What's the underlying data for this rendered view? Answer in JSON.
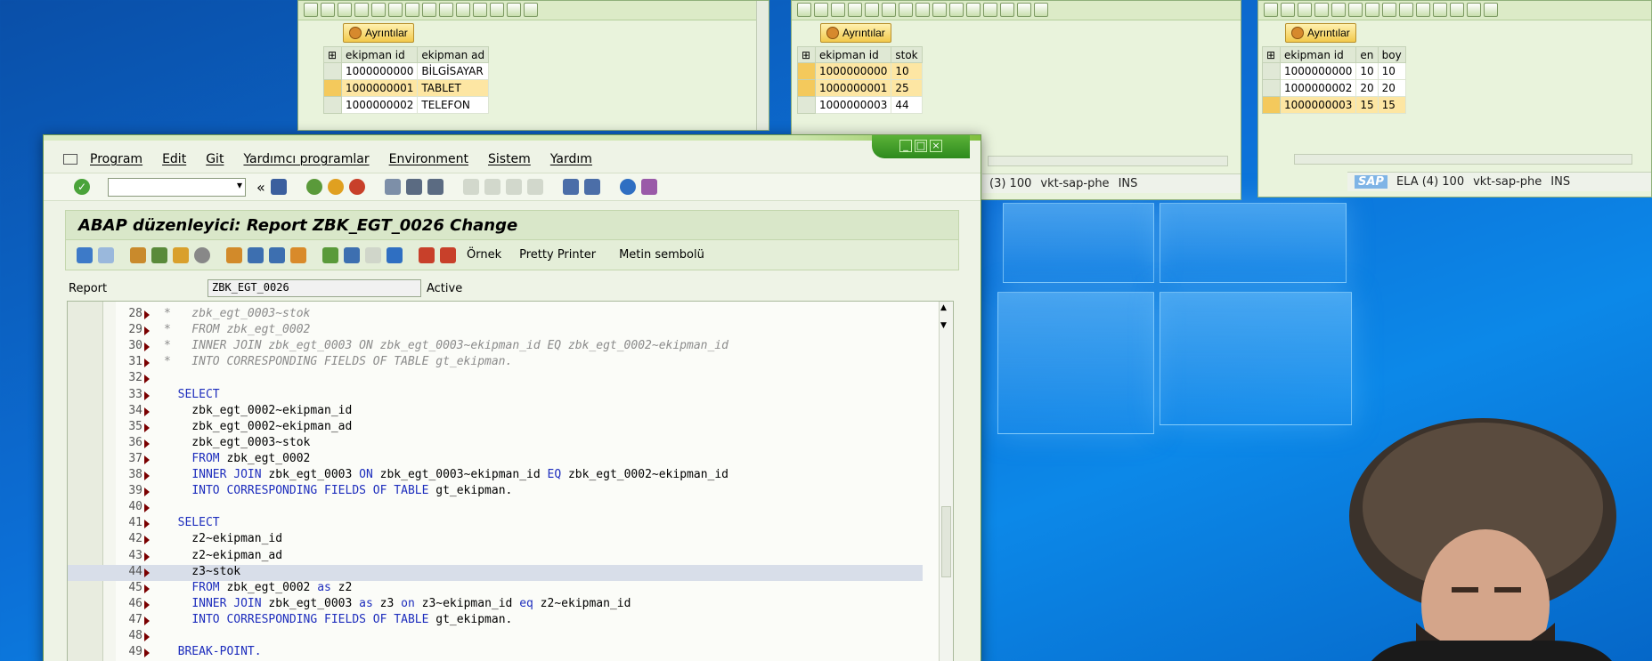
{
  "main_window": {
    "menu": [
      "Program",
      "Edit",
      "Git",
      "Yardımcı programlar",
      "Environment",
      "Sistem",
      "Yardım"
    ],
    "window_controls": [
      "_",
      "□",
      "×"
    ],
    "title": "ABAP düzenleyici: Report ZBK_EGT_0026 Change",
    "toolbar_buttons": [
      "Örnek",
      "Pretty Printer",
      "Metin sembolü"
    ],
    "report_label": "Report",
    "report_name": "ZBK_EGT_0026",
    "report_status": "Active",
    "code_lines": [
      {
        "n": "28",
        "text": "*   zbk_egt_0003~stok",
        "style": "cm"
      },
      {
        "n": "29",
        "text": "*   FROM zbk_egt_0002",
        "style": "cm"
      },
      {
        "n": "30",
        "text": "*   INNER JOIN zbk_egt_0003 ON zbk_egt_0003~ekipman_id EQ zbk_egt_0002~ekipman_id",
        "style": "cm"
      },
      {
        "n": "31",
        "text": "*   INTO CORRESPONDING FIELDS OF TABLE gt_ekipman.",
        "style": "cm"
      },
      {
        "n": "32",
        "text": "",
        "style": ""
      },
      {
        "n": "33",
        "text": "  SELECT",
        "style": "kw"
      },
      {
        "n": "34",
        "text": "    zbk_egt_0002~ekipman_id",
        "style": ""
      },
      {
        "n": "35",
        "text": "    zbk_egt_0002~ekipman_ad",
        "style": ""
      },
      {
        "n": "36",
        "text": "    zbk_egt_0003~stok",
        "style": ""
      },
      {
        "n": "37",
        "text": "    FROM zbk_egt_0002",
        "style": "mix"
      },
      {
        "n": "38",
        "text": "    INNER JOIN zbk_egt_0003 ON zbk_egt_0003~ekipman_id EQ zbk_egt_0002~ekipman_id",
        "style": "mix"
      },
      {
        "n": "39",
        "text": "    INTO CORRESPONDING FIELDS OF TABLE gt_ekipman.",
        "style": "mix"
      },
      {
        "n": "40",
        "text": "",
        "style": ""
      },
      {
        "n": "41",
        "text": "  SELECT",
        "style": "kw"
      },
      {
        "n": "42",
        "text": "    z2~ekipman_id",
        "style": ""
      },
      {
        "n": "43",
        "text": "    z2~ekipman_ad",
        "style": ""
      },
      {
        "n": "44",
        "text": "    z3~stok",
        "style": "cur"
      },
      {
        "n": "45",
        "text": "    FROM zbk_egt_0002 as z2",
        "style": "mix"
      },
      {
        "n": "46",
        "text": "    INNER JOIN zbk_egt_0003 as z3 on z3~ekipman_id eq z2~ekipman_id",
        "style": "mix"
      },
      {
        "n": "47",
        "text": "    INTO CORRESPONDING FIELDS OF TABLE gt_ekipman.",
        "style": "mix"
      },
      {
        "n": "48",
        "text": "",
        "style": ""
      },
      {
        "n": "49",
        "text": "  BREAK-POINT.",
        "style": "kw"
      }
    ]
  },
  "bg_window_1": {
    "button": "Ayrıntılar",
    "headers": [
      "ekipman id",
      "ekipman ad"
    ],
    "rows": [
      [
        "1000000000",
        "BİLGİSAYAR"
      ],
      [
        "1000000001",
        "TABLET"
      ],
      [
        "1000000002",
        "TELEFON"
      ]
    ],
    "highlight_row": 1
  },
  "bg_window_2": {
    "button": "Ayrıntılar",
    "headers": [
      "ekipman id",
      "stok"
    ],
    "rows": [
      [
        "1000000000",
        "10"
      ],
      [
        "1000000001",
        "25"
      ],
      [
        "1000000003",
        "44"
      ]
    ],
    "status": [
      "(3) 100",
      "vkt-sap-phe",
      "INS"
    ]
  },
  "bg_window_3": {
    "button": "Ayrıntılar",
    "headers": [
      "ekipman id",
      "en",
      "boy"
    ],
    "rows": [
      [
        "1000000000",
        "10",
        "10"
      ],
      [
        "1000000002",
        "20",
        "20"
      ],
      [
        "1000000003",
        "15",
        "15"
      ]
    ],
    "highlight_row": 2,
    "status": [
      "SAP",
      "ELA (4) 100",
      "vkt-sap-phe",
      "INS"
    ]
  }
}
